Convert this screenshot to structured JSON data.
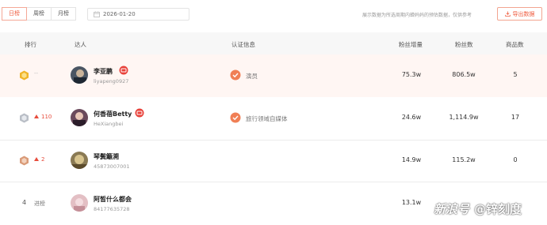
{
  "toolbar": {
    "tabs": [
      {
        "label": "日榜",
        "active": true
      },
      {
        "label": "周榜",
        "active": false
      },
      {
        "label": "月榜",
        "active": false
      }
    ],
    "date": "2026-01-20",
    "note": "展示数据为所选周期内蝉妈妈的预估数据，仅供参考",
    "export_label": "导出数据"
  },
  "columns": {
    "rank": "排行",
    "talent": "达人",
    "cert": "认证信息",
    "fans_growth": "粉丝增量",
    "fans": "粉丝数",
    "products": "商品数"
  },
  "rows": [
    {
      "rank": "1",
      "trend": "--",
      "trend_type": "same",
      "name": "李亚鹏",
      "handle": "liyapeng0927",
      "live": true,
      "cert": "演员",
      "fans_growth": "75.3w",
      "fans": "806.5w",
      "products": "5",
      "badge_color": "#f0b429"
    },
    {
      "rank": "2",
      "trend": "110",
      "trend_type": "up",
      "name": "何香蓓Betty",
      "handle": "HeXiangbei",
      "live": true,
      "cert": "旅行领域自媒体",
      "fans_growth": "24.6w",
      "fans": "1,114.9w",
      "products": "17",
      "badge_color": "#b9bec6"
    },
    {
      "rank": "3",
      "trend": "2",
      "trend_type": "up",
      "name": "琴鬓籬溯",
      "handle": "45873007001",
      "live": false,
      "cert": "",
      "fans_growth": "14.9w",
      "fans": "115.2w",
      "products": "0",
      "badge_color": "#d99a77"
    },
    {
      "rank": "4",
      "trend": "进榜",
      "trend_type": "new",
      "name": "阿皙什么都会",
      "handle": "84177635728",
      "live": false,
      "cert": "",
      "fans_growth": "13.1w",
      "fans": "",
      "products": "",
      "badge_color": ""
    }
  ],
  "watermark": {
    "logo": "新浪号",
    "text": "@锌刻度"
  },
  "colors": {
    "accent": "#ef5a3c",
    "live_red": "#e8413a",
    "cert_orange": "#f07f55"
  }
}
